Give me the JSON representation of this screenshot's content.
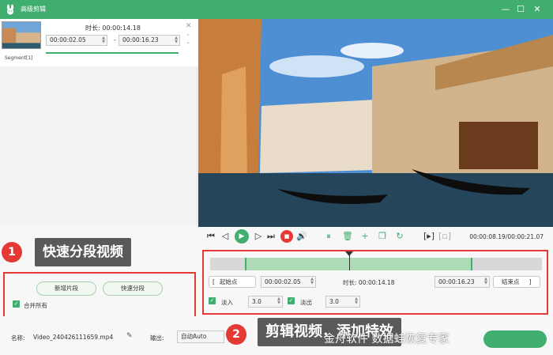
{
  "window": {
    "title": "高级剪辑",
    "logo_icon": "rabbit-logo-icon",
    "accent": "#3fae6f"
  },
  "segment_list": {
    "segment_label": "Segment[1]",
    "duration_label": "时长:",
    "duration_value": "00:00:14.18",
    "start_time": "00:00:02.05",
    "end_time": "00:00:16.23",
    "separator": "-"
  },
  "segment_actions": {
    "new_segment": "新增片段",
    "quick_split": "快速分段",
    "merge_all": "合并所有"
  },
  "callouts": [
    {
      "number": "1",
      "text": "快速分段视频"
    },
    {
      "number": "2",
      "text": "剪辑视频，添加特效"
    }
  ],
  "player": {
    "current_time": "00:00:08.19",
    "total_time": "00:00:21.07",
    "time_separator": "/"
  },
  "trim": {
    "start_label": "起始点",
    "start_value": "00:00:02.05",
    "duration_label": "时长:",
    "duration_value": "00:00:14.18",
    "end_value": "00:00:16.23",
    "end_label": "结束点",
    "fade_in_label": "淡入",
    "fade_in_value": "3.0",
    "fade_out_label": "淡出",
    "fade_out_value": "3.0",
    "marker_position": 0.42
  },
  "bottom": {
    "name_label": "名称:",
    "file_name": "Video_240426111659.mp4",
    "output_label": "输出:",
    "output_value": "自动Auto"
  },
  "watermark": "金舟软件 数据蛙恢复专家"
}
